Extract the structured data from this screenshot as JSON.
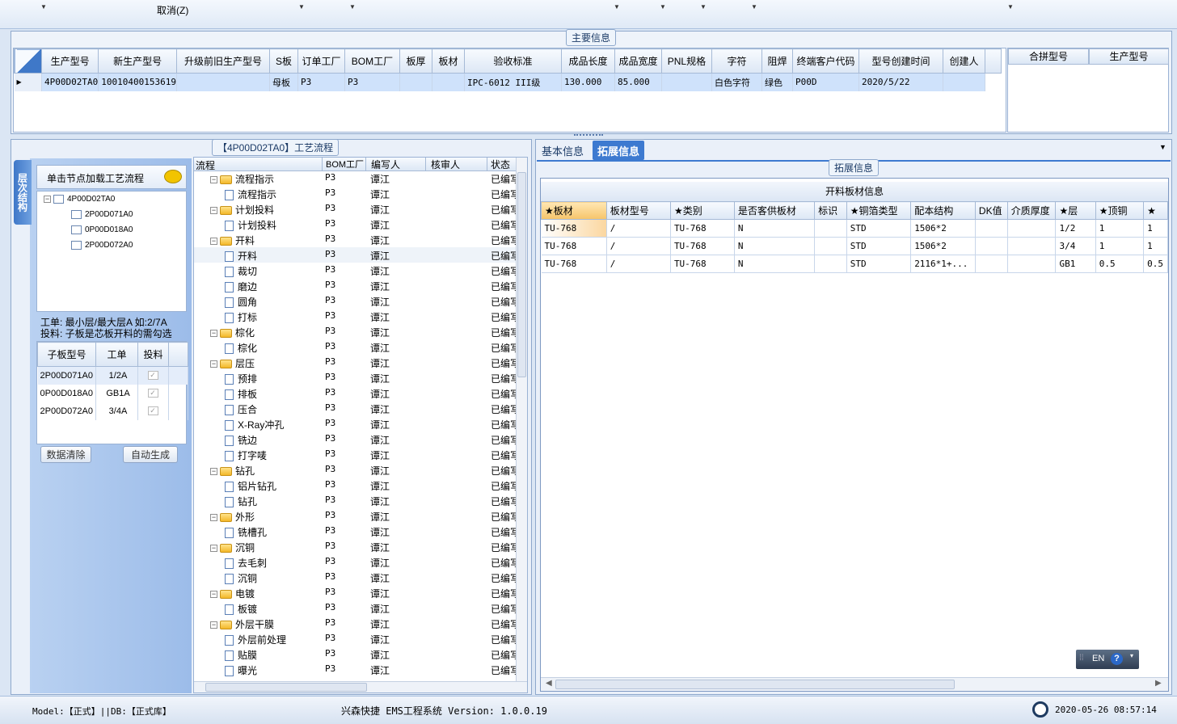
{
  "toolbar": {
    "cancel_label": "取消(Z)"
  },
  "main_info": {
    "group_title": "主要信息",
    "columns": [
      "生产型号",
      "新生产型号",
      "升级前旧生产型号",
      "S板",
      "订单工厂",
      "BOM工厂",
      "板厚",
      "板材",
      "验收标准",
      "成品长度",
      "成品宽度",
      "PNL规格",
      "字符",
      "阻焊",
      "终端客户代码",
      "型号创建时间",
      "创建人"
    ],
    "row": [
      "4P00D02TA0",
      "10010400153619",
      "",
      "母板",
      "P3",
      "P3",
      "",
      "",
      "IPC-6012 III级",
      "130.000",
      "85.000",
      "",
      "白色字符",
      "绿色",
      "P00D",
      "2020/5/22",
      ""
    ],
    "side_columns": [
      "合拼型号",
      "生产型号"
    ]
  },
  "left": {
    "side_tab_label": "层次结构",
    "header_hint": "单击节点加载工艺流程",
    "tree_root": "4P00D02TA0",
    "tree_children": [
      "2P00D071A0",
      "0P00D018A0",
      "2P00D072A0"
    ],
    "note_line1": "工单: 最小层/最大层A 如:2/7A",
    "note_line2": "投料: 子板是芯板开料的需勾选",
    "sub_columns": [
      "子板型号",
      "工单",
      "投料"
    ],
    "sub_rows": [
      [
        "2P00D071A0",
        "1/2A"
      ],
      [
        "0P00D018A0",
        "GB1A"
      ],
      [
        "2P00D072A0",
        "3/4A"
      ]
    ],
    "clear_button": "数据清除",
    "auto_button": "自动生成"
  },
  "process": {
    "title": "【4P00D02TA0】工艺流程",
    "columns": [
      "流程",
      "BOM工厂",
      "编写人",
      "核审人",
      "状态"
    ],
    "factory": "P3",
    "writer": "谭江",
    "status": "已编写",
    "rows": [
      {
        "name": "流程指示",
        "folder": true
      },
      {
        "name": "流程指示",
        "folder": false
      },
      {
        "name": "计划投料",
        "folder": true
      },
      {
        "name": "计划投料",
        "folder": false
      },
      {
        "name": "开料",
        "folder": true
      },
      {
        "name": "开料",
        "folder": false
      },
      {
        "name": "裁切",
        "folder": false
      },
      {
        "name": "磨边",
        "folder": false
      },
      {
        "name": "圆角",
        "folder": false
      },
      {
        "name": "打标",
        "folder": false
      },
      {
        "name": "棕化",
        "folder": true
      },
      {
        "name": "棕化",
        "folder": false
      },
      {
        "name": "层压",
        "folder": true
      },
      {
        "name": "预排",
        "folder": false
      },
      {
        "name": "排板",
        "folder": false
      },
      {
        "name": "压合",
        "folder": false
      },
      {
        "name": "X-Ray冲孔",
        "folder": false
      },
      {
        "name": "铣边",
        "folder": false
      },
      {
        "name": "打字唛",
        "folder": false
      },
      {
        "name": "钻孔",
        "folder": true
      },
      {
        "name": "铝片钻孔",
        "folder": false
      },
      {
        "name": "钻孔",
        "folder": false
      },
      {
        "name": "外形",
        "folder": true
      },
      {
        "name": "铣槽孔",
        "folder": false
      },
      {
        "name": "沉铜",
        "folder": true
      },
      {
        "name": "去毛刺",
        "folder": false
      },
      {
        "name": "沉铜",
        "folder": false
      },
      {
        "name": "电镀",
        "folder": true
      },
      {
        "name": "板镀",
        "folder": false
      },
      {
        "name": "外层干膜",
        "folder": true
      },
      {
        "name": "外层前处理",
        "folder": false
      },
      {
        "name": "贴膜",
        "folder": false
      },
      {
        "name": "曝光",
        "folder": false
      }
    ]
  },
  "right": {
    "tabs": [
      "基本信息",
      "拓展信息"
    ],
    "group_title": "拓展信息",
    "table_caption": "开料板材信息",
    "columns": [
      "★板材",
      "板材型号",
      "★类别",
      "是否客供板材",
      "标识",
      "★铜箔类型",
      "配本结构",
      "DK值",
      "介质厚度",
      "★层",
      "★顶铜",
      "★"
    ],
    "rows": [
      [
        "TU-768",
        "/",
        "TU-768",
        "N",
        "",
        "STD",
        "1506*2",
        "",
        "",
        "1/2",
        "1",
        "1"
      ],
      [
        "TU-768",
        "/",
        "TU-768",
        "N",
        "",
        "STD",
        "1506*2",
        "",
        "",
        "3/4",
        "1",
        "1"
      ],
      [
        "TU-768",
        "/",
        "TU-768",
        "N",
        "",
        "STD",
        "2116*1+...",
        "",
        "",
        "GB1",
        "0.5",
        "0.5"
      ]
    ],
    "ime_label": "EN"
  },
  "status": {
    "left": "Model:【正式】||DB:【正式库】",
    "center": "兴森快捷 EMS工程系统 Version: 1.0.0.19",
    "datetime": "2020-05-26 08:57:14"
  },
  "colors": {
    "accent": "#3f78c8",
    "selected_row": "#cfe2fb",
    "tab_active": "#3d7ad0"
  }
}
